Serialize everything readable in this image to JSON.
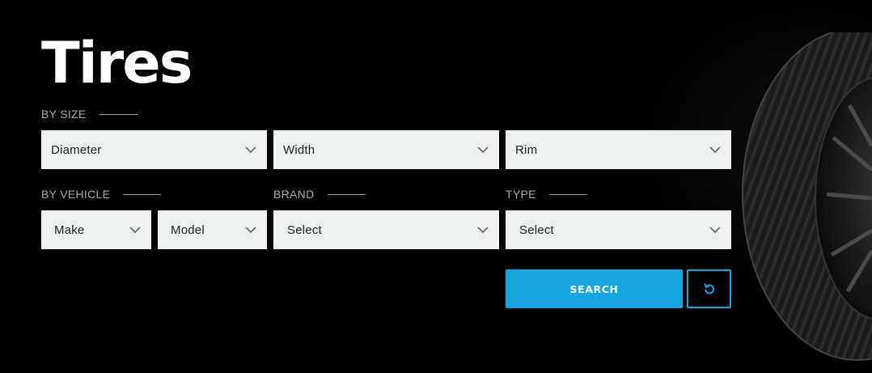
{
  "page": {
    "title": "Tires"
  },
  "by_size": {
    "label": "BY SIZE",
    "fields": [
      {
        "value": "Diameter"
      },
      {
        "value": "Width"
      },
      {
        "value": "Rim"
      }
    ]
  },
  "by_vehicle": {
    "label": "BY VEHICLE",
    "make": {
      "value": "Make"
    },
    "model": {
      "value": "Model"
    }
  },
  "brand": {
    "label": "BRAND",
    "value": "Select"
  },
  "type": {
    "label": "TYPE",
    "value": "Select"
  },
  "actions": {
    "search_label": "SEARCH",
    "reset_icon": "refresh-icon"
  },
  "colors": {
    "accent": "#15a6e0",
    "background": "#000000",
    "field_bg": "#edf0f1"
  }
}
